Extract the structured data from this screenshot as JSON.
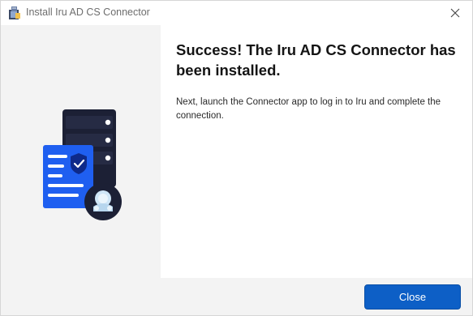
{
  "window": {
    "title": "Install Iru AD CS Connector"
  },
  "main": {
    "heading": "Success! The Iru AD CS Connector has been installed.",
    "description": "Next, launch the Connector app to log in to Iru and complete the connection."
  },
  "footer": {
    "close_label": "Close"
  },
  "icons": {
    "app": "installer-icon",
    "titlebar_close": "close-icon",
    "illustration": "connector-illustration"
  },
  "colors": {
    "accent": "#0d5fc6",
    "document": "#1f5ff0",
    "server": "#1c2035"
  }
}
